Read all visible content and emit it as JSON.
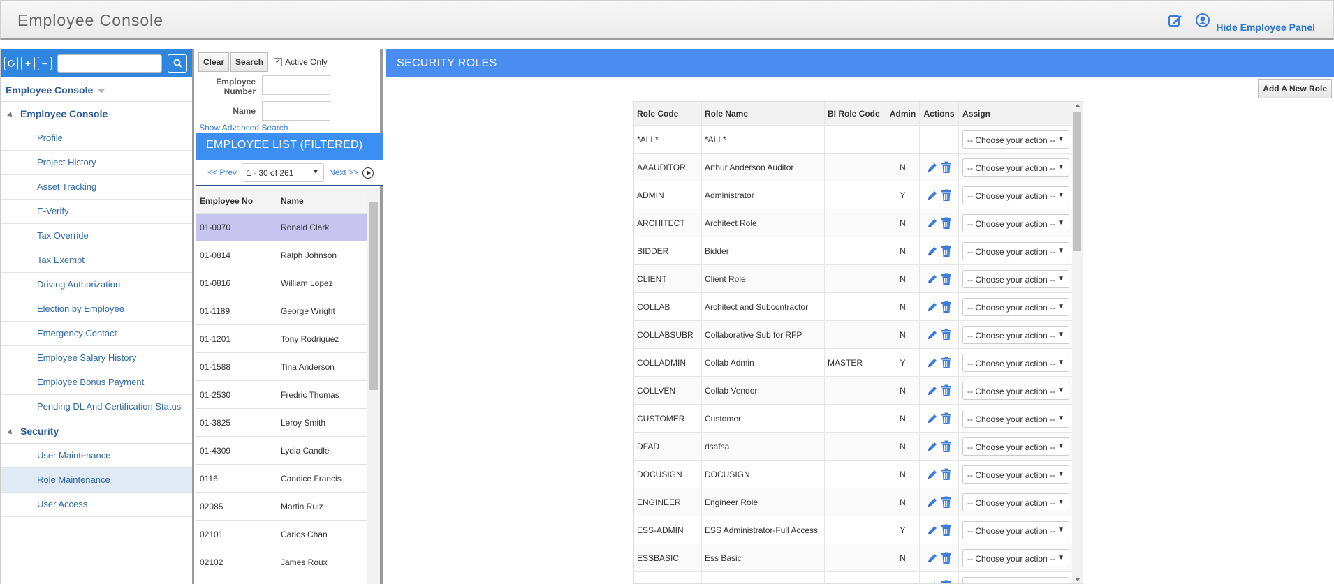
{
  "header": {
    "title": "Employee Console",
    "hide_panel": "Hide Employee Panel",
    "edit_icon": "edit-note-icon",
    "user_icon": "user-circle-icon"
  },
  "sidebar": {
    "dropdown_label": "Employee Console",
    "group_employee": "Employee Console",
    "employee_items": [
      "Profile",
      "Project History",
      "Asset Tracking",
      "E-Verify",
      "Tax Override",
      "Tax Exempt",
      "Driving Authorization",
      "Election by Employee",
      "Emergency Contact",
      "Employee Salary History",
      "Employee Bonus Payment",
      "Pending DL And Certification Status"
    ],
    "group_security": "Security",
    "security_items": [
      "User Maintenance",
      "Role Maintenance",
      "User Access"
    ],
    "active_item": "Role Maintenance"
  },
  "employee_panel": {
    "clear_label": "Clear",
    "search_label": "Search",
    "active_only_label": "Active Only",
    "active_only_checked": true,
    "employee_number_label": "Employee Number",
    "name_label": "Name",
    "advanced_search": "Show Advanced Search",
    "list_title": "EMPLOYEE LIST (FILTERED)",
    "prev_label": "<< Prev",
    "next_label": "Next >>",
    "page_range": "1 - 30 of 261",
    "columns": [
      "Employee No",
      "Name"
    ],
    "rows": [
      [
        "01-0070",
        "Ronald Clark"
      ],
      [
        "01-0814",
        "Ralph Johnson"
      ],
      [
        "01-0816",
        "William Lopez"
      ],
      [
        "01-1189",
        "George Wright"
      ],
      [
        "01-1201",
        "Tony Rodriguez"
      ],
      [
        "01-1588",
        "Tina Anderson"
      ],
      [
        "01-2530",
        "Fredric Thomas"
      ],
      [
        "01-3825",
        "Leroy Smith"
      ],
      [
        "01-4309",
        "Lydia Candle"
      ],
      [
        "0116",
        "Candice Francis"
      ],
      [
        "02085",
        "Martin Ruiz"
      ],
      [
        "02101",
        "Carlos Chan"
      ],
      [
        "02102",
        "James Roux"
      ]
    ]
  },
  "main": {
    "title": "SECURITY ROLES",
    "add_role": "Add A New Role",
    "assign_placeholder": "-- Choose your action --",
    "columns": [
      "Role Code",
      "Role Name",
      "BI Role Code",
      "Admin",
      "Actions",
      "Assign"
    ],
    "rows": [
      {
        "code": "*ALL*",
        "name": "*ALL*",
        "bi": "",
        "admin": "",
        "actions": false
      },
      {
        "code": "AAAUDITOR",
        "name": "Arthur Anderson Auditor",
        "bi": "",
        "admin": "N",
        "actions": true
      },
      {
        "code": "ADMIN",
        "name": "Administrator",
        "bi": "",
        "admin": "Y",
        "actions": true
      },
      {
        "code": "ARCHITECT",
        "name": "Architect Role",
        "bi": "",
        "admin": "N",
        "actions": true
      },
      {
        "code": "BIDDER",
        "name": "Bidder",
        "bi": "",
        "admin": "N",
        "actions": true
      },
      {
        "code": "CLIENT",
        "name": "Client Role",
        "bi": "",
        "admin": "N",
        "actions": true
      },
      {
        "code": "COLLAB",
        "name": "Architect and Subcontractor",
        "bi": "",
        "admin": "N",
        "actions": true
      },
      {
        "code": "COLLABSUBR",
        "name": "Collaborative Sub for RFP",
        "bi": "",
        "admin": "N",
        "actions": true
      },
      {
        "code": "COLLADMIN",
        "name": "Collab Admin",
        "bi": "MASTER",
        "admin": "Y",
        "actions": true
      },
      {
        "code": "COLLVEN",
        "name": "Collab Vendor",
        "bi": "",
        "admin": "N",
        "actions": true
      },
      {
        "code": "CUSTOMER",
        "name": "Customer",
        "bi": "",
        "admin": "N",
        "actions": true
      },
      {
        "code": "DFAD",
        "name": "dsafsa",
        "bi": "",
        "admin": "N",
        "actions": true
      },
      {
        "code": "DOCUSIGN",
        "name": "DOCUSIGN",
        "bi": "",
        "admin": "N",
        "actions": true
      },
      {
        "code": "ENGINEER",
        "name": "Engineer Role",
        "bi": "",
        "admin": "N",
        "actions": true
      },
      {
        "code": "ESS-ADMIN",
        "name": "ESS Administrator-Full Access",
        "bi": "",
        "admin": "Y",
        "actions": true
      },
      {
        "code": "ESSBASIC",
        "name": "Ess Basic",
        "bi": "",
        "admin": "N",
        "actions": true
      },
      {
        "code": "ETIMEADMIN",
        "name": "ETIME ADMIN",
        "bi": "",
        "admin": "N",
        "actions": true
      }
    ]
  },
  "colors": {
    "accent": "#2e86de",
    "header_blue": "#4a8df2",
    "link": "#2f6aa8",
    "selected_row": "#c7c5f0",
    "active_item": "#dfeaf5",
    "icon_blue": "#3b7dd8"
  }
}
